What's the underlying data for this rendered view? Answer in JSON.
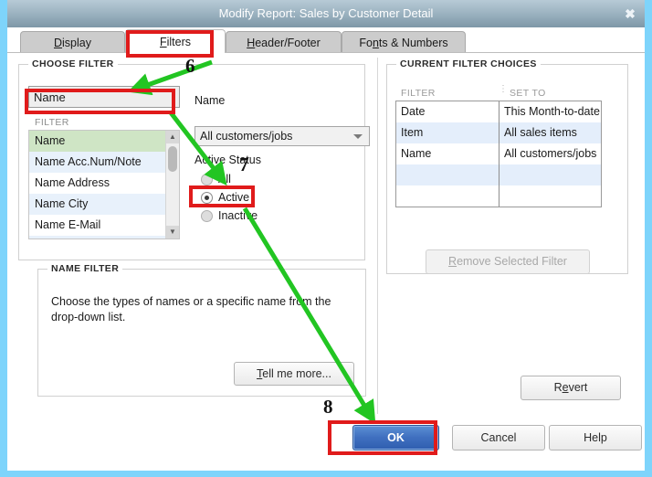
{
  "window": {
    "title": "Modify Report: Sales by Customer Detail",
    "close_icon": "close-icon",
    "close_glyph": "✖"
  },
  "tabs": [
    {
      "label": "Display",
      "accel": "D",
      "active": false
    },
    {
      "label": "Filters",
      "accel": "F",
      "active": true
    },
    {
      "label": "Header/Footer",
      "accel": "H",
      "active": false
    },
    {
      "label": "Fonts & Numbers",
      "accel": "n",
      "active": false
    }
  ],
  "choose_filter": {
    "group_title": "CHOOSE FILTER",
    "search_value": "Name",
    "list_header": "FILTER",
    "items": [
      {
        "label": "Name",
        "selected": true
      },
      {
        "label": "Name Acc.Num/Note",
        "selected": false
      },
      {
        "label": "Name Address",
        "selected": false
      },
      {
        "label": "Name City",
        "selected": false
      },
      {
        "label": "Name E-Mail",
        "selected": false
      },
      {
        "label": "",
        "selected": false
      }
    ],
    "scroll_up_glyph": "▲",
    "scroll_down_glyph": "▼"
  },
  "filter_detail": {
    "heading": "Name",
    "dropdown_value": "All customers/jobs",
    "status_label": "Active Status",
    "radios": [
      {
        "label": "All",
        "checked": false
      },
      {
        "label": "Active",
        "checked": true
      },
      {
        "label": "Inactive",
        "checked": false
      }
    ]
  },
  "name_filter": {
    "group_title": "NAME FILTER",
    "description_line1": "Choose the types of names or a specific name from the",
    "description_line2": "drop-down list.",
    "tell_me_more_label": "Tell me more...",
    "tell_me_more_accel": "T"
  },
  "current_filter_choices": {
    "group_title": "CURRENT FILTER CHOICES",
    "columns": [
      "FILTER",
      "SET TO"
    ],
    "rows": [
      {
        "filter": "Date",
        "set_to": "This Month-to-date"
      },
      {
        "filter": "Item",
        "set_to": "All sales items"
      },
      {
        "filter": "Name",
        "set_to": "All customers/jobs"
      },
      {
        "filter": "",
        "set_to": ""
      },
      {
        "filter": "",
        "set_to": ""
      }
    ],
    "remove_button_label": "Remove Selected Filter",
    "remove_button_accel": "R",
    "remove_button_enabled": false
  },
  "footer": {
    "revert_label": "Revert",
    "revert_accel": "e",
    "ok_label": "OK",
    "cancel_label": "Cancel",
    "help_label": "Help"
  },
  "annotations": {
    "numbers": [
      {
        "text": "6"
      },
      {
        "text": "7"
      },
      {
        "text": "8"
      }
    ],
    "highlight_color": "#e01b1b",
    "arrow_color": "#22c522"
  }
}
